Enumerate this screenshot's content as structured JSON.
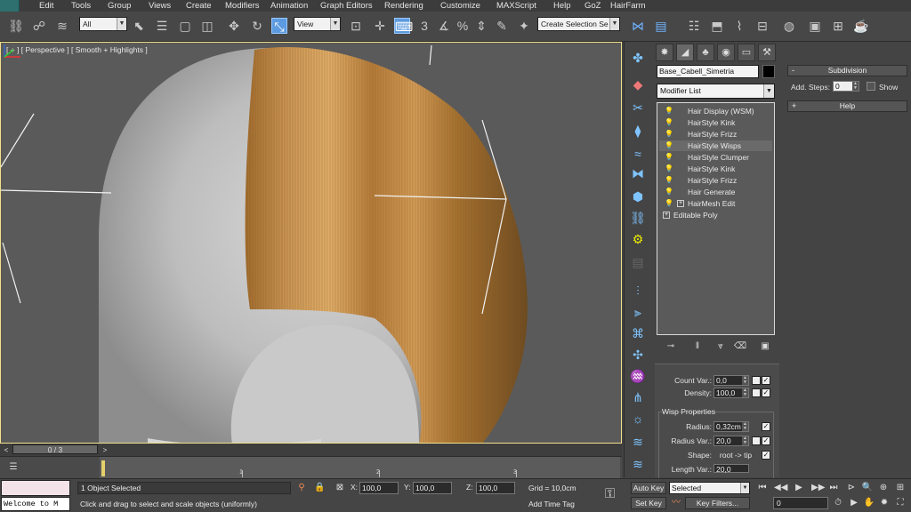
{
  "menu": {
    "items": [
      "Edit",
      "Tools",
      "Group",
      "Views",
      "Create",
      "Modifiers",
      "Animation",
      "Graph Editors",
      "Rendering",
      "Customize",
      "MAXScript",
      "Help",
      "GoZ",
      "HairFarm"
    ]
  },
  "toolbar": {
    "selection_filter": "All",
    "ref_coord": "View",
    "named_selection": "Create Selection Se"
  },
  "viewport": {
    "label": "[ + ] [ Perspective ] [ Smooth + Highlights ]",
    "hair_color": "#c08a42",
    "bg_color": "#5a5a5a"
  },
  "panel": {
    "object_name": "Base_Cabell_Simetria",
    "object_color": "#000000",
    "modifier_list": "Modifier List",
    "stack": [
      {
        "label": "Hair Display (WSM)",
        "plus": false
      },
      {
        "label": "HairStyle Kink",
        "plus": false
      },
      {
        "label": "HairStyle Frizz",
        "plus": false
      },
      {
        "label": "HairStyle Wisps",
        "plus": false
      },
      {
        "label": "HairStyle Clumper",
        "plus": false
      },
      {
        "label": "HairStyle Kink",
        "plus": false
      },
      {
        "label": "HairStyle Frizz",
        "plus": false
      },
      {
        "label": "Hair Generate",
        "plus": false
      },
      {
        "label": "HairMesh Edit",
        "plus": true
      },
      {
        "label": "Editable Poly",
        "plus": true,
        "root": true
      }
    ],
    "params": {
      "count_var_label": "Count Var.:",
      "count_var": "0,0",
      "density_label": "Density:",
      "density": "100,0",
      "wisp_group": "Wisp Properties",
      "radius_label": "Radius:",
      "radius": "0,32cm",
      "radius_var_label": "Radius Var.:",
      "radius_var": "20,0",
      "shape_label": "Shape:",
      "shape": "root -> tip",
      "length_var_label": "Length Var.:",
      "length_var": "20,0"
    }
  },
  "rpanel": {
    "subdivision": "Subdivision",
    "add_steps_label": "Add. Steps:",
    "add_steps": "0",
    "show_label": "Show",
    "help": "Help"
  },
  "timeline": {
    "slider": "0 / 3",
    "ticks": [
      "1",
      "2",
      "3"
    ]
  },
  "status": {
    "welcome": "Welcome to M",
    "selected": "1 Object Selected",
    "prompt": "Click and drag to select and scale objects (uniformly)",
    "x_label": "X:",
    "x": "100,0",
    "y_label": "Y:",
    "y": "100,0",
    "z_label": "Z:",
    "z": "100,0",
    "grid": "Grid = 10,0cm",
    "add_time_tag": "Add Time Tag",
    "auto_key": "Auto Key",
    "set_key": "Set Key",
    "selected_dropdown": "Selected",
    "key_filters": "Key Filters...",
    "frame": "0"
  }
}
